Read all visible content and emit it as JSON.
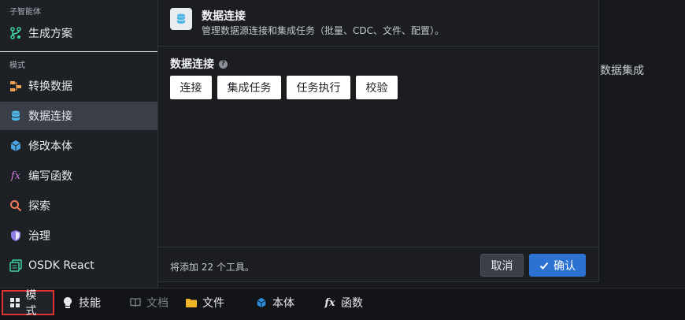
{
  "sidebar": {
    "section_agents": "子智能体",
    "generate_plan": "生成方案",
    "section_modes": "模式",
    "items": [
      {
        "label": "转换数据",
        "icon": "pipeline-icon"
      },
      {
        "label": "数据连接",
        "icon": "database-icon"
      },
      {
        "label": "修改本体",
        "icon": "cube-icon"
      },
      {
        "label": "编写函数",
        "icon": "function-icon"
      },
      {
        "label": "探索",
        "icon": "search-icon"
      },
      {
        "label": "治理",
        "icon": "shield-icon"
      },
      {
        "label": "OSDK React",
        "icon": "app-icon"
      }
    ],
    "active_index": 1
  },
  "background": {
    "partial_text": "数据集成"
  },
  "panel": {
    "title": "数据连接",
    "description": "管理数据源连接和集成任务（批量、CDC、文件、配置）。",
    "section_title": "数据连接",
    "chips": [
      "连接",
      "集成任务",
      "任务执行",
      "校验"
    ],
    "footer_note": "将添加 22 个工具。",
    "cancel_label": "取消",
    "confirm_label": "确认"
  },
  "bottombar": {
    "tabs": [
      {
        "label": "模式",
        "icon": "grid-icon",
        "active": true
      },
      {
        "label": "技能",
        "icon": "lightbulb-icon"
      },
      {
        "label": "文档",
        "icon": "book-icon",
        "disabled": true
      },
      {
        "label": "文件",
        "icon": "folder-icon"
      },
      {
        "label": "本体",
        "icon": "cube-icon"
      },
      {
        "label": "函数",
        "icon": "function-icon"
      }
    ]
  },
  "colors": {
    "accent": "#2d72d2",
    "active_tab_border": "#e03131",
    "database_icon": "#4fb6e8"
  }
}
